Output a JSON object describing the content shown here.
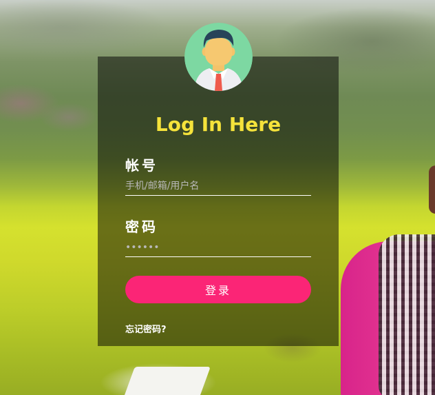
{
  "login": {
    "title": "Log In Here",
    "username_label": "帐号",
    "username_placeholder": "手机/邮箱/用户名",
    "password_label": "密码",
    "password_placeholder": "••••••",
    "submit_label": "登录",
    "forgot_label": "忘记密码?"
  },
  "icons": {
    "avatar": "user-avatar-icon"
  },
  "colors": {
    "title": "#f5e33b",
    "button": "#fb2576",
    "panel": "rgba(0,0,0,0.5)",
    "avatar_bg": "#7dd8a2"
  }
}
